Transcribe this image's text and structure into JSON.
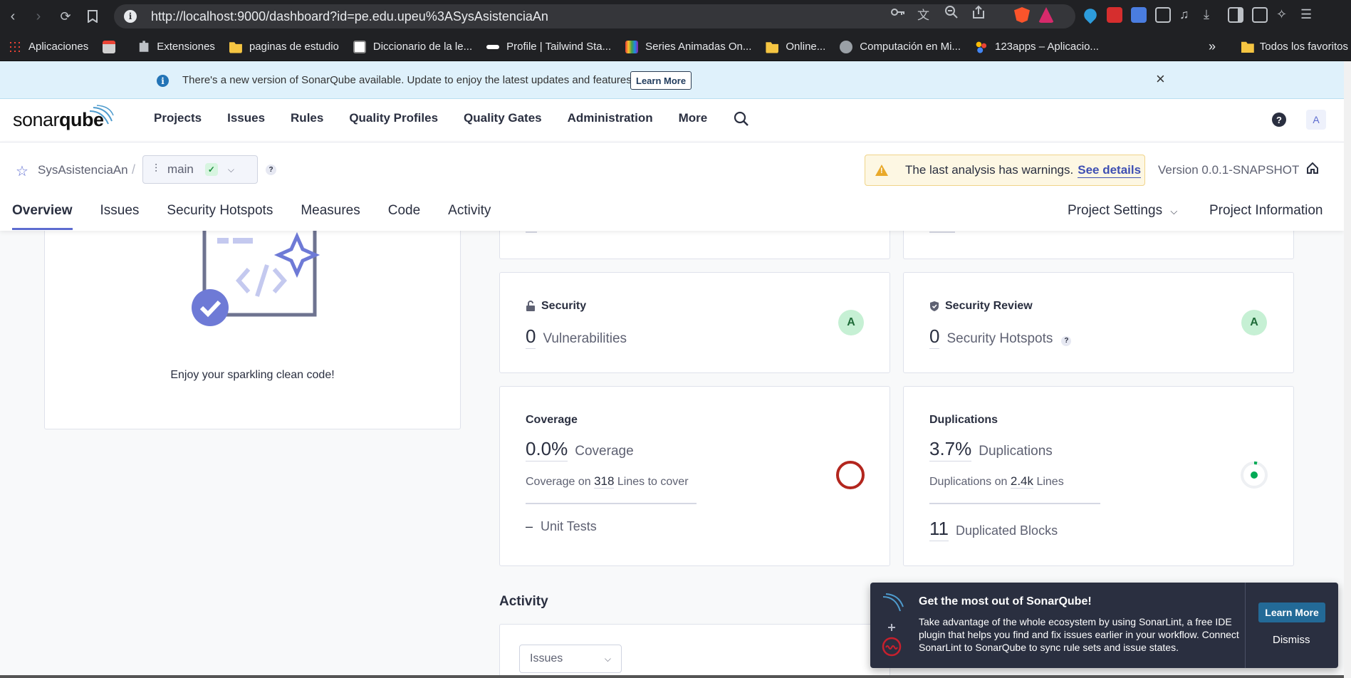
{
  "browser": {
    "url": "http://localhost:9000/dashboard?id=pe.edu.upeu%3ASysAsistenciaAn",
    "bookmarks": [
      {
        "label": "Aplicaciones",
        "icon": "apps-grid-icon"
      },
      {
        "label": "",
        "icon": "bookmark-app-icon"
      },
      {
        "label": "Extensiones",
        "icon": "puzzle-icon"
      },
      {
        "label": "paginas de estudio",
        "icon": "folder-icon"
      },
      {
        "label": "Diccionario de la le...",
        "icon": "book-icon"
      },
      {
        "label": "Profile | Tailwind Sta...",
        "icon": "tailwind-icon"
      },
      {
        "label": "Series Animadas On...",
        "icon": "tv-icon"
      },
      {
        "label": "Online...",
        "icon": "folder-icon"
      },
      {
        "label": "Computación en Mi...",
        "icon": "globe-icon"
      },
      {
        "label": "123apps – Aplicacio...",
        "icon": "dots-icon"
      }
    ],
    "bookmarks_more": "»",
    "all_bookmarks": "Todos los favoritos"
  },
  "banner": {
    "text": "There's a new version of SonarQube available. Update to enjoy the latest updates and features.",
    "learn_more": "Learn More",
    "close": "×"
  },
  "header": {
    "logo_light": "sonar",
    "logo_bold": "qube",
    "nav": [
      "Projects",
      "Issues",
      "Rules",
      "Quality Profiles",
      "Quality Gates",
      "Administration",
      "More"
    ],
    "help": "?",
    "avatar": "A"
  },
  "project": {
    "name": "SysAsistenciaAn",
    "branch": "main",
    "warning_text": "The last analysis has warnings.",
    "warning_link": "See details",
    "version": "Version 0.0.1-SNAPSHOT",
    "tabs": [
      "Overview",
      "Issues",
      "Security Hotspots",
      "Measures",
      "Code",
      "Activity"
    ],
    "settings": "Project Settings",
    "information": "Project Information"
  },
  "overview": {
    "clean_text": "Enjoy your sparkling clean code!",
    "security": {
      "title": "Security",
      "value": "0",
      "label": "Vulnerabilities",
      "grade": "A"
    },
    "security_review": {
      "title": "Security Review",
      "value": "0",
      "label": "Security Hotspots",
      "help": "?",
      "grade": "A"
    },
    "coverage": {
      "title": "Coverage",
      "value": "0.0%",
      "label": "Coverage",
      "sub_prefix": "Coverage on",
      "sub_num": "318",
      "sub_suffix": "Lines to cover",
      "unit_dash": "–",
      "unit_label": "Unit Tests"
    },
    "duplications": {
      "title": "Duplications",
      "value": "3.7%",
      "label": "Duplications",
      "sub_prefix": "Duplications on",
      "sub_num": "2.4k",
      "sub_suffix": "Lines",
      "blocks_value": "11",
      "blocks_label": "Duplicated Blocks"
    },
    "activity_title": "Activity",
    "activity_select": "Issues"
  },
  "promo": {
    "title": "Get the most out of SonarQube!",
    "body": "Take advantage of the whole ecosystem by using SonarLint, a free IDE plugin that helps you find and fix issues earlier in your workflow. Connect SonarLint to SonarQube to sync rule sets and issue states.",
    "learn_more": "Learn More",
    "dismiss": "Dismiss"
  },
  "colors": {
    "accent": "#5d6cd0",
    "grade_a_bg": "#c6f0d4",
    "coverage_ring": "#b3261e",
    "duplication_ring": "#00aa55"
  }
}
